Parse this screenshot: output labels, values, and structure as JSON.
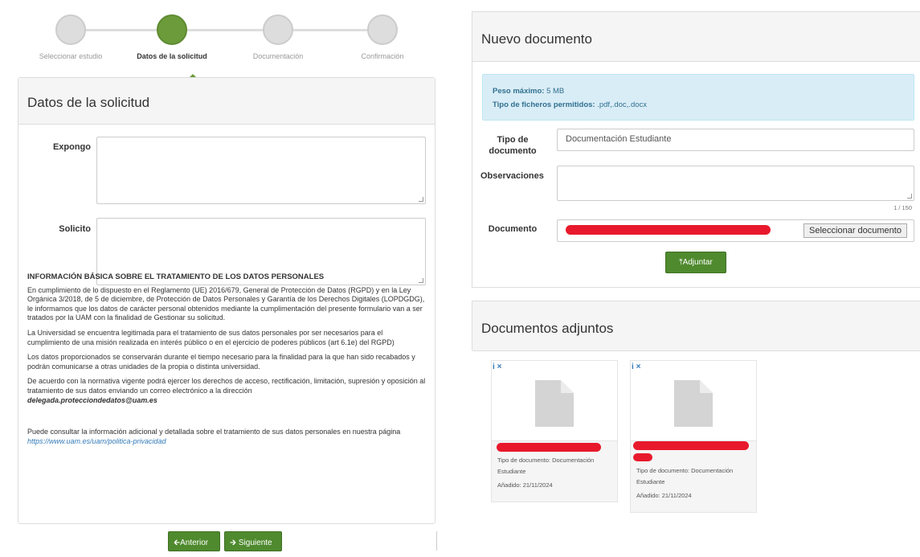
{
  "stepper": {
    "steps": [
      "Seleccionar estudio",
      "Datos de la solicitud",
      "Documentación",
      "Confirmación"
    ],
    "active_index": 1
  },
  "solicitud": {
    "title": "Datos de la solicitud",
    "expongo_label": "Expongo",
    "expongo_value": "",
    "solicito_label": "Solicito",
    "solicito_value": ""
  },
  "privacy": {
    "heading": "INFORMACIÓN BÁSICA SOBRE EL TRATAMIENTO DE LOS DATOS PERSONALES",
    "p1": "En cumplimiento de lo dispuesto en el Reglamento (UE) 2016/679, General de Protección de Datos (RGPD) y en la Ley Orgánica 3/2018, de 5 de diciembre, de Protección de Datos Personales y Garantía de los Derechos Digitales (LOPDGDG), le informamos que los datos de carácter personal obtenidos mediante la cumplimentación del presente formulario van a ser tratados por la UAM con la finalidad de Gestionar su solicitud.",
    "p2": "La Universidad se encuentra legitimada para el tratamiento de sus datos personales por ser necesarios para el cumplimiento de una misión realizada en interés público o en el ejercicio de poderes públicos (art 6.1e) del RGPD)",
    "p3": "Los datos proporcionados se conservarán durante el tiempo necesario para la finalidad para la que han sido recabados y podrán comunicarse a otras unidades de la propia o distinta universidad.",
    "p4": "De acuerdo con la normativa vigente podrá ejercer los derechos de acceso, rectificación, limitación, supresión y oposición al tratamiento de sus datos enviando un correo electrónico a la dirección",
    "email": "delegada.protecciondedatos@uam.es",
    "p5": "Puede consultar la información adicional y detallada sobre el tratamiento de sus datos personales en nuestra página",
    "link": "https://www.uam.es/uam/politica-privacidad"
  },
  "nav": {
    "prev_label": "Anterior",
    "next_label": "Siguiente"
  },
  "nuevo": {
    "title": "Nuevo documento",
    "max_label": "Peso máximo:",
    "max_value": "5 MB",
    "types_label": "Tipo de ficheros permitidos:",
    "types_value": ".pdf,.doc,.docx",
    "tipo_label_1": "Tipo de",
    "tipo_label_2": "documento",
    "tipo_value": "Documentación Estudiante",
    "obs_label": "Observaciones",
    "obs_value": "",
    "counter": "1 / 150",
    "doc_label": "Documento",
    "select_label": "Seleccionar documento",
    "attach_label": "Adjuntar"
  },
  "adjuntos": {
    "title": "Documentos adjuntos",
    "cards": [
      {
        "type_text": "Tipo de documento: Documentación Estudiante",
        "added": "Añadido: 21/11/2024"
      },
      {
        "type_text": "Tipo de documento: Documentación Estudiante",
        "added": "Añadido: 21/11/2024"
      }
    ],
    "info_icon": "i",
    "remove_icon": "×"
  },
  "colors": {
    "accent_green": "#4f8a2e",
    "step_active": "#6b9b3a",
    "alert_bg": "#d9edf7",
    "redaction": "#e8192c"
  }
}
